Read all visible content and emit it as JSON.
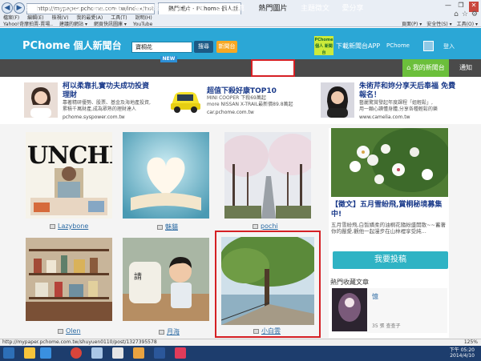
{
  "browser": {
    "address": "http://mypaper.pchome.com.tw/index/hot-img",
    "tab_title": "熱門圖片 - PChome 個人新...",
    "menu": [
      "檔案(F)",
      "編輯(E)",
      "檢視(V)",
      "我的最愛(A)",
      "工具(T)",
      "說明(H)"
    ],
    "favorites": [
      "Yahoo!奇摩拍賣-賣場..",
      "建議的網站 ▾",
      "網頁快訊圖庫 ▾",
      "YouTube"
    ],
    "tools": [
      "頁面(P) ▾",
      "安全性(S) ▾",
      "工具(O) ▾"
    ]
  },
  "site": {
    "logo": "PChome",
    "logo_cn": "個人新聞台",
    "search_value": "寶桐花",
    "search_btn": "搜尋",
    "news_btn": "新聞台",
    "app_badge": "PChome 個人 新聞台",
    "app_link": "下載新聞台APP",
    "user_link": "PChome",
    "login": "登入"
  },
  "nav": {
    "items": [
      "首頁",
      "哈燒文章",
      "最新文章",
      "醫師部落",
      "達人知識",
      "好台推薦",
      "熱門圖片",
      "主題徵文",
      "愛分享"
    ],
    "new_badge": "NEW",
    "my_news": "我的新聞台",
    "notify": "通知"
  },
  "ads": [
    {
      "title": "柯以柔靠扎實功夫成功投資",
      "title2": "理財",
      "desc": "靠著精研優勢、股票、基金及海地產投資,",
      "desc2": "累積千萬財產,成為眾熟的理財達人",
      "url": "pchome.syspower.com.tw"
    },
    {
      "title": "超值下殺好康TOP10",
      "title2": "",
      "desc": "MINI COOPER 下殺69萬起",
      "desc2": "more NISSAN X-TRAIL最新價89.8萬起",
      "url": "car.pchome.com.tw"
    },
    {
      "title": "朱術芹和妳分享天后奉福 免費",
      "title2": "報名！",
      "desc": "藝麗驚賞發起年度課程「姐輕鬆」,",
      "desc2": "用一顆心讀懂身體,分享各種輕鬆的樂",
      "url": "www.camelia.com.tw"
    }
  ],
  "gallery": [
    {
      "label": "Lazybone"
    },
    {
      "label": "魅貓"
    },
    {
      "label": "pochi"
    },
    {
      "label": "Olen"
    },
    {
      "label": "月海"
    },
    {
      "label": "小白雲"
    }
  ],
  "thumb_text": {
    "lunchbox": "UNCHBO"
  },
  "side": {
    "title": "【徵文】五月雪紛飛,賞桐秘境募集中!",
    "text": "五月雪紛飛,白皙嬌柔的油桐花隨紛盛開散~~蓄著你的嚴愛,觀他一起漫步在山林裡享受純...",
    "post_btn": "我要投稿",
    "fav_title": "熱門收藏文章",
    "fav_item": "憶",
    "fav_meta": "35 張 查查子"
  },
  "status": {
    "url": "http://mypaper.pchome.com.tw/shuyuen0110/post/1327395578",
    "zoom": "125%",
    "time": "下午 05:20",
    "date": "2014/4/10"
  }
}
